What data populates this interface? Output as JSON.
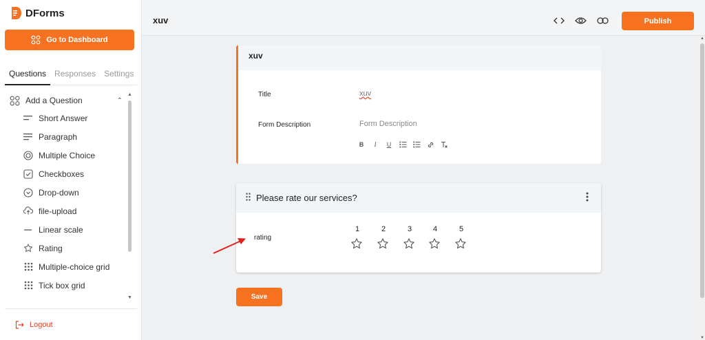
{
  "app": {
    "name": "DForms"
  },
  "sidebar": {
    "dashboard_label": "Go to Dashboard",
    "tabs": [
      {
        "label": "Questions",
        "active": true
      },
      {
        "label": "Responses",
        "active": false
      },
      {
        "label": "Settings",
        "active": false
      }
    ],
    "add_question_label": "Add a Question",
    "question_types": [
      {
        "label": "Short Answer",
        "icon": "short-answer-icon"
      },
      {
        "label": "Paragraph",
        "icon": "paragraph-icon"
      },
      {
        "label": "Multiple Choice",
        "icon": "radio-icon"
      },
      {
        "label": "Checkboxes",
        "icon": "checkbox-icon"
      },
      {
        "label": "Drop-down",
        "icon": "dropdown-icon"
      },
      {
        "label": "file-upload",
        "icon": "upload-icon"
      },
      {
        "label": "Linear scale",
        "icon": "linear-scale-icon"
      },
      {
        "label": "Rating",
        "icon": "star-icon"
      },
      {
        "label": "Multiple-choice grid",
        "icon": "grid-icon"
      },
      {
        "label": "Tick box grid",
        "icon": "grid-icon"
      }
    ],
    "logout_label": "Logout"
  },
  "header": {
    "form_name": "xuv",
    "publish_label": "Publish"
  },
  "form_card": {
    "heading": "xuv",
    "title_label": "Title",
    "title_value": "xuv",
    "description_label": "Form Description",
    "description_placeholder": "Form Description",
    "toolbar": [
      "B",
      "I",
      "U",
      "ol",
      "ul",
      "link",
      "Tx"
    ]
  },
  "question_card": {
    "title": "Please rate our services?",
    "field_label": "rating",
    "scale": [
      "1",
      "2",
      "3",
      "4",
      "5"
    ]
  },
  "save_label": "Save",
  "colors": {
    "accent": "#f77220",
    "logout": "#e0452a"
  }
}
